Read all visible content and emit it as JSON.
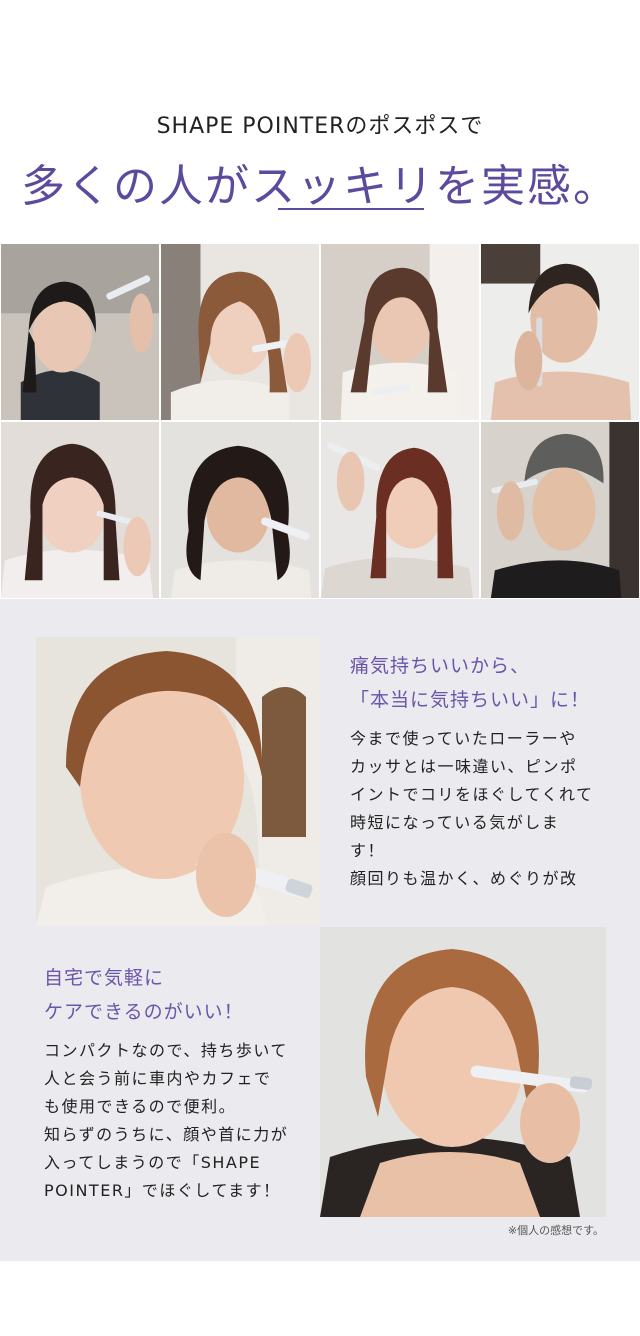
{
  "hero": {
    "subtitle": "SHAPE POINTERのポスポスで",
    "title": "多くの人がスッキリを実感。"
  },
  "voices": [
    {
      "title_lines": [
        "痛気持ちいいから、",
        "「本当に気持ちいい」に！"
      ],
      "body_lines": [
        "今まで使っていたローラーや",
        "カッサとは一味違い、ピンポ",
        "イントでコリをほぐしてくれて",
        "時短になっている気がしま",
        "す！",
        "顔回りも温かく、めぐりが改"
      ]
    },
    {
      "title_lines": [
        "自宅で気軽に",
        "ケアできるのがいい！"
      ],
      "body_lines": [
        "コンパクトなので、持ち歩いて",
        "人と会う前に車内やカフェで",
        "も使用できるので便利。",
        "知らずのうちに、顔や首に力が",
        "入ってしまうので「SHAPE",
        "POINTER」でほぐしてます！"
      ]
    }
  ],
  "disclaimer": "※個人の感想です。",
  "colors": {
    "accent": "#5b4a9e",
    "voice_title": "#6a55a8",
    "panel_bg": "#ebebef"
  }
}
